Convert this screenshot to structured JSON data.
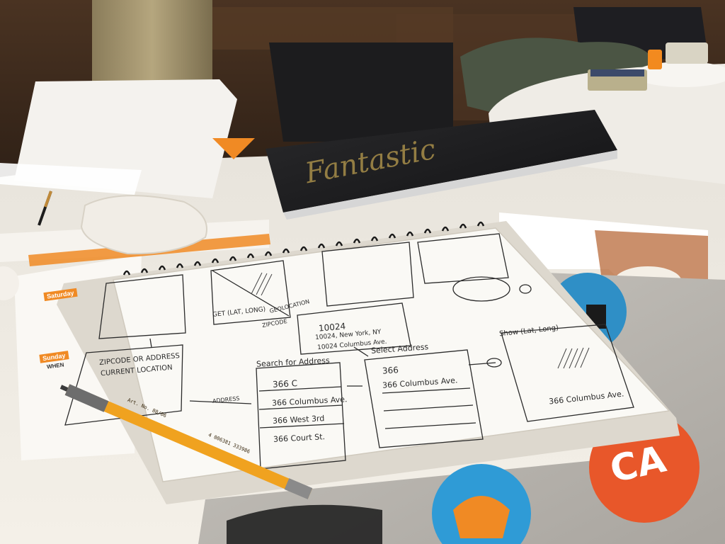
{
  "laptop": {
    "lid_script": "Fantastic"
  },
  "schedule": {
    "day_saturday": "Saturday",
    "day_sunday": "Sunday",
    "label_when": "WHEN"
  },
  "notebook": {
    "heading_search": "Search for Address",
    "heading_select": "Select Address",
    "heading_show": "Show (Lat, Long)",
    "screen1_item_zip": "ZIPCODE OR ADDRESS",
    "screen1_item_location": "CURRENT LOCATION",
    "screen2_item_get": "GET (LAT, LONG)",
    "search_query": "366 C",
    "search_results": [
      "366 Columbus Ave.",
      "366 West 3rd",
      "366 Court St."
    ],
    "select_query": "366",
    "select_result": "366 Columbus Ave.",
    "zip_entry": "10024",
    "zip_results": [
      "10024, New York, NY",
      "10024 Columbus Ave."
    ],
    "show_address": "366 Columbus Ave.",
    "arrow_label_zipcode": "ZIPCODE",
    "arrow_label_address": "ADDRESS",
    "arrow_label_geolocation": "GEOLOCATION"
  },
  "pen": {
    "label_article": "Art. No. 88/06",
    "barcode_number": "4 006381 333986"
  },
  "sticker": {
    "text": "CA"
  }
}
